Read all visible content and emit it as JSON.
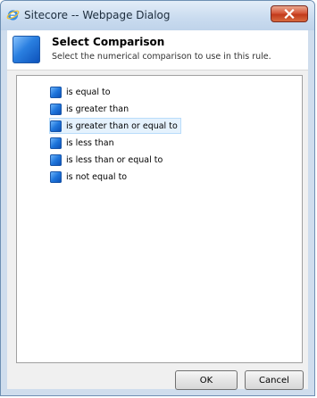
{
  "window": {
    "title": "Sitecore -- Webpage Dialog"
  },
  "header": {
    "title": "Select Comparison",
    "subtitle": "Select the numerical comparison to use in this rule."
  },
  "comparisons": [
    {
      "label": "is equal to",
      "selected": false
    },
    {
      "label": "is greater than",
      "selected": false
    },
    {
      "label": "is greater than or equal to",
      "selected": true
    },
    {
      "label": "is less than",
      "selected": false
    },
    {
      "label": "is less than or equal to",
      "selected": false
    },
    {
      "label": "is not equal to",
      "selected": false
    }
  ],
  "buttons": {
    "ok_label": "OK",
    "cancel_label": "Cancel"
  },
  "colors": {
    "titlebar": "#c9dbef",
    "close_button": "#c23a1b",
    "item_icon": "#1f76dc",
    "selection": "#e5f2fd"
  }
}
